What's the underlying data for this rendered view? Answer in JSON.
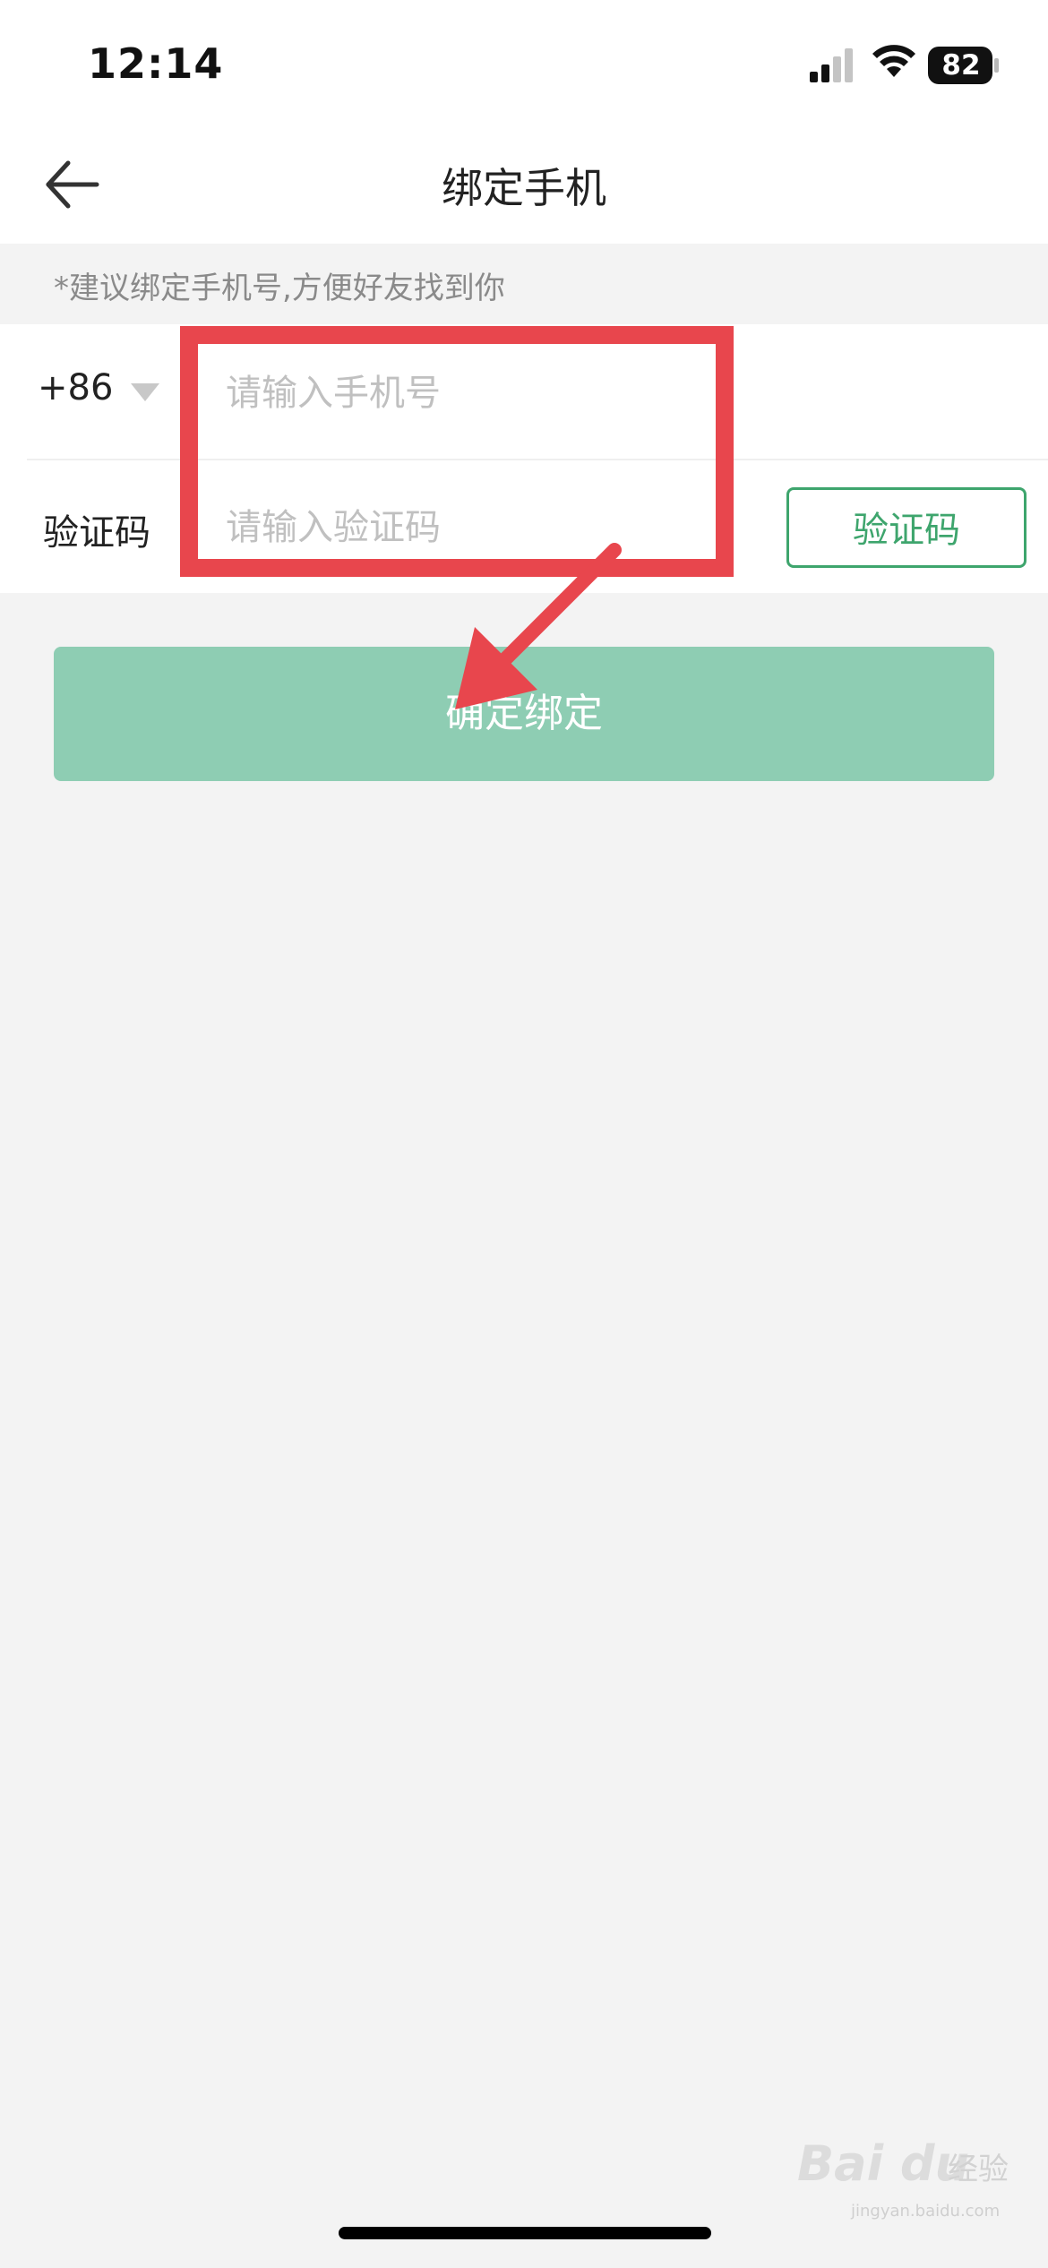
{
  "status_bar": {
    "time": "12:14",
    "battery": "82",
    "icons": [
      "signal-icon",
      "wifi-icon",
      "battery-icon"
    ]
  },
  "nav": {
    "title": "绑定手机",
    "back_icon": "back-arrow-icon"
  },
  "hint": "*建议绑定手机号,方便好友找到你",
  "form": {
    "country_code": "+86",
    "phone_placeholder": "请输入手机号",
    "phone_value": "",
    "code_label": "验证码",
    "code_placeholder": "请输入验证码",
    "code_value": "",
    "code_button": "验证码"
  },
  "confirm_button": "确定绑定",
  "colors": {
    "accent": "#3ea56d",
    "confirm_bg": "#8ecdb3",
    "annotation": "#e8464d",
    "page_bg": "#f3f3f3"
  },
  "watermark": {
    "brand": "Bai du",
    "cn": "经验",
    "domain": "jingyan.baidu.com"
  }
}
